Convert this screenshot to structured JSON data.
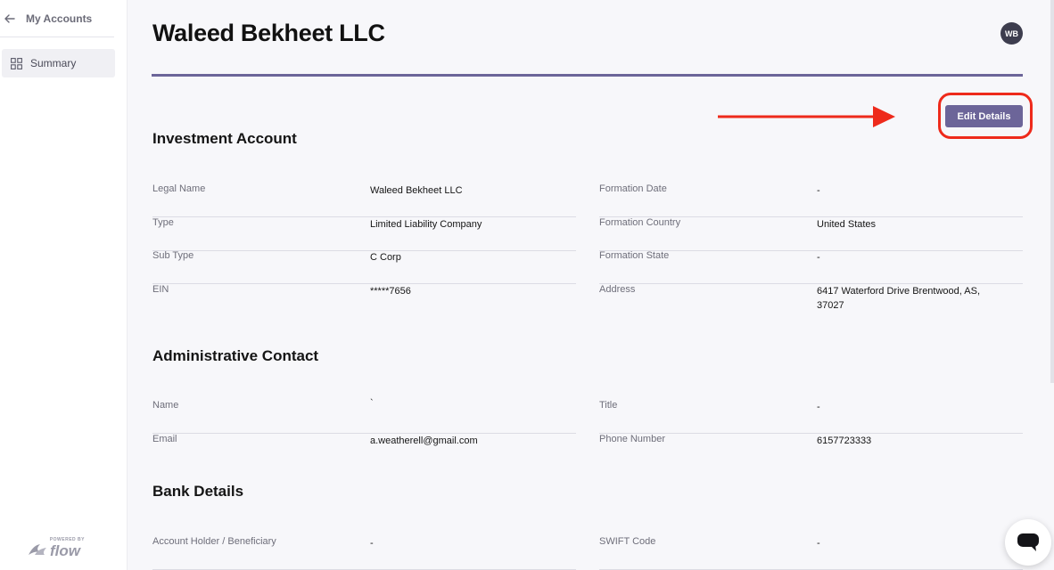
{
  "sidebar": {
    "back_label": "My Accounts",
    "nav": [
      {
        "label": "Summary",
        "icon": "grid-icon"
      }
    ],
    "powered_by": "POWERED BY",
    "brand": "flow"
  },
  "header": {
    "title": "Waleed Bekheet LLC",
    "avatar_initials": "WB",
    "edit_label": "Edit Details"
  },
  "colors": {
    "accent": "#6c6599",
    "annotation": "#ee2a1b"
  },
  "investment": {
    "title": "Investment Account",
    "left": [
      {
        "key": "Legal Name",
        "value": "Waleed Bekheet LLC"
      },
      {
        "key": "Type",
        "value": "Limited Liability Company"
      },
      {
        "key": "Sub Type",
        "value": "C Corp"
      },
      {
        "key": "EIN",
        "value": "*****7656"
      }
    ],
    "right": [
      {
        "key": "Formation Date",
        "value": "-"
      },
      {
        "key": "Formation Country",
        "value": "United States"
      },
      {
        "key": "Formation State",
        "value": "-"
      },
      {
        "key": "Address",
        "value": "6417 Waterford Drive Brentwood, AS, 37027"
      }
    ]
  },
  "admin": {
    "title": "Administrative Contact",
    "left": [
      {
        "key": "Name",
        "value": "`"
      },
      {
        "key": "Email",
        "value": "a.weatherell@gmail.com"
      }
    ],
    "right": [
      {
        "key": "Title",
        "value": "-"
      },
      {
        "key": "Phone Number",
        "value": "6157723333"
      }
    ]
  },
  "bank": {
    "title": "Bank Details",
    "left": [
      {
        "key": "Account Holder / Beneficiary",
        "value": "-"
      }
    ],
    "right": [
      {
        "key": "SWIFT Code",
        "value": "-"
      }
    ]
  }
}
